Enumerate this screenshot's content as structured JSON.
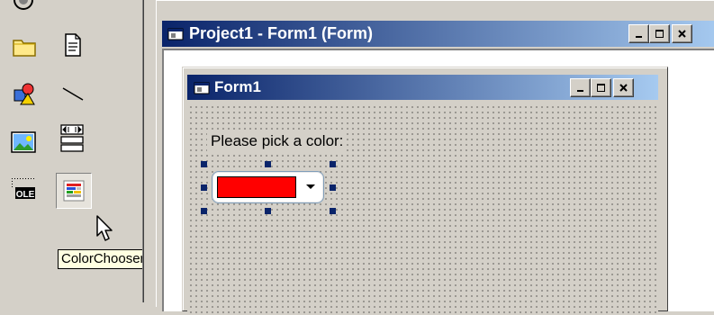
{
  "toolbox": {
    "tools": [
      {
        "name": "folder-tool",
        "icon": "folder-icon"
      },
      {
        "name": "file-tool",
        "icon": "file-icon"
      },
      {
        "name": "shape-tool",
        "icon": "shape-icon"
      },
      {
        "name": "line-tool",
        "icon": "line-icon"
      },
      {
        "name": "image-tool",
        "icon": "image-icon"
      },
      {
        "name": "data-tool",
        "icon": "data-control-icon"
      },
      {
        "name": "ole-tool",
        "icon": "ole-icon",
        "label": "OLE"
      },
      {
        "name": "colorchooser-tool",
        "icon": "colorchooser-icon",
        "selected": true
      }
    ],
    "tooltip": "ColorChooser"
  },
  "project_window": {
    "title": "Project1 - Form1 (Form)"
  },
  "form_window": {
    "title": "Form1",
    "label": "Please pick a color:",
    "color_chooser": {
      "selected_color": "#ff0000"
    }
  },
  "colors": {
    "titlebar_start": "#0a246a",
    "titlebar_end": "#a6caf0",
    "face": "#d4d0c8",
    "tooltip_bg": "#ffffe1"
  }
}
